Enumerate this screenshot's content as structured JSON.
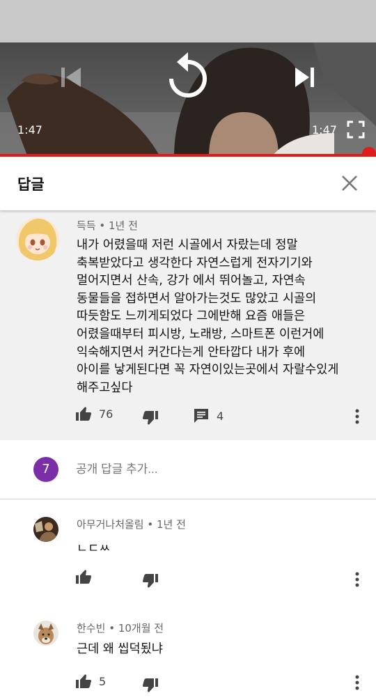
{
  "player": {
    "time_left": "1:47",
    "time_right": "1:47",
    "progress": 1.0,
    "accent": "#e01b1b"
  },
  "header": {
    "title": "답글",
    "close_icon": "close-icon"
  },
  "main_comment": {
    "author": "득득",
    "age": "1년 전",
    "body_lines": [
      "내가 어렸을때 저런 시골에서 자랐는데 정말",
      "축복받았다고 생각한다 자연스럽게 전자기기와",
      "멀어지면서 산속, 강가 에서 뛰어놀고, 자연속",
      "동물들을 접하면서 알아가는것도 많았고 시골의",
      "따듯함도 느끼게되었다 그에반해 요즘 애들은",
      "어렸을때부터 피시방, 노래방, 스마트폰 이런거에",
      "익숙해지면서 커간다는게 안타깝다 내가 후에",
      "아이를 낳게된다면 꼭 자연이있는곳에서 자랄수있게",
      "해주고싶다"
    ],
    "likes": "76",
    "replies": "4"
  },
  "add_reply": {
    "user_initial": "7",
    "placeholder": "공개 답글 추가...",
    "badge_color": "#7a2fa8"
  },
  "replies": [
    {
      "author": "아무거나처올림",
      "age": "1년 전",
      "body": "ㄴㄷㅆ",
      "likes": ""
    },
    {
      "author": "한수빈",
      "age": "10개월 전",
      "body": "근데 왜 씹덕됬냐",
      "likes": "5"
    }
  ]
}
